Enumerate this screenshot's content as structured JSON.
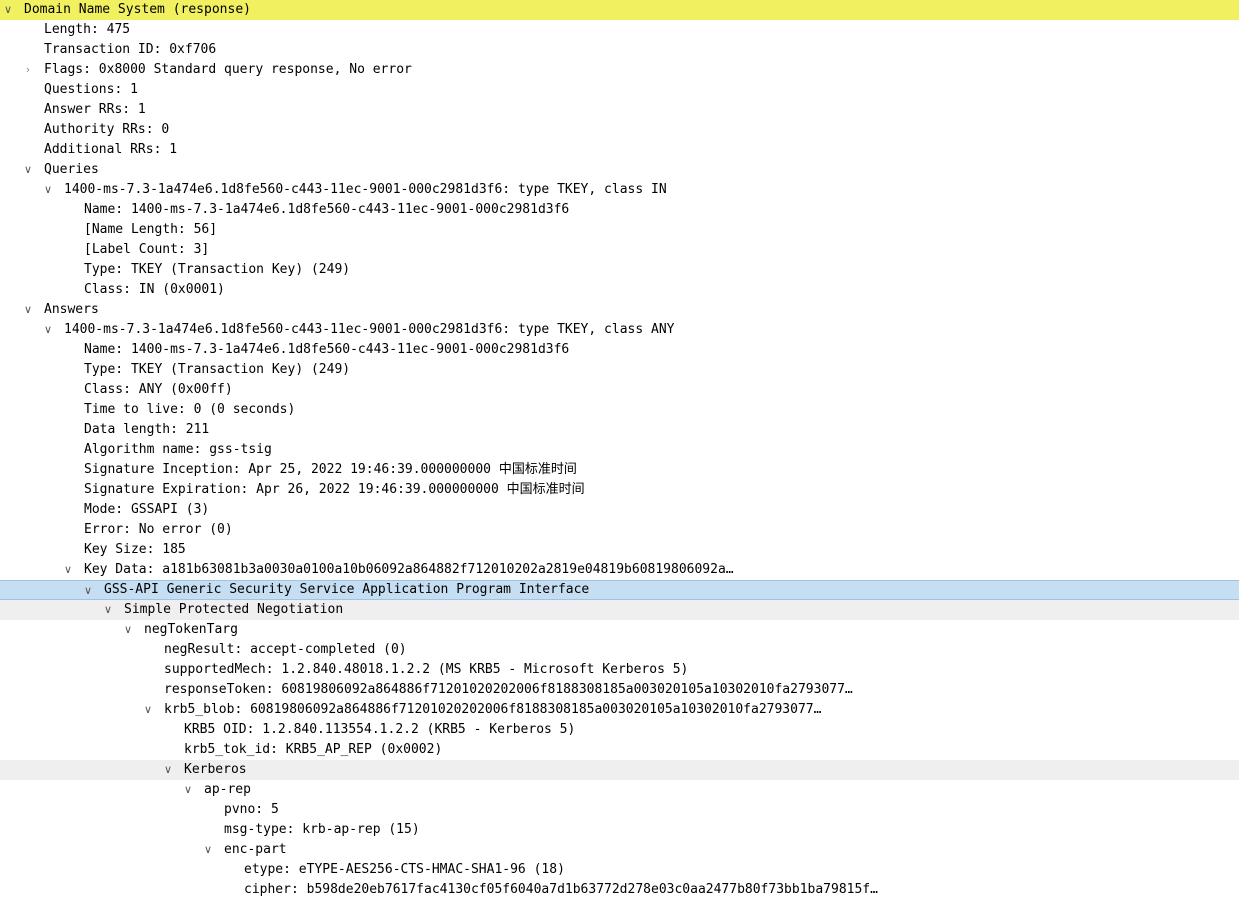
{
  "tree": [
    {
      "level": 0,
      "toggle": "expanded",
      "hl": "yellow",
      "text": "Domain Name System (response)"
    },
    {
      "level": 1,
      "toggle": "none",
      "text": "Length: 475"
    },
    {
      "level": 1,
      "toggle": "none",
      "text": "Transaction ID: 0xf706"
    },
    {
      "level": 1,
      "toggle": "collapsed",
      "text": "Flags: 0x8000 Standard query response, No error"
    },
    {
      "level": 1,
      "toggle": "none",
      "text": "Questions: 1"
    },
    {
      "level": 1,
      "toggle": "none",
      "text": "Answer RRs: 1"
    },
    {
      "level": 1,
      "toggle": "none",
      "text": "Authority RRs: 0"
    },
    {
      "level": 1,
      "toggle": "none",
      "text": "Additional RRs: 1"
    },
    {
      "level": 1,
      "toggle": "expanded",
      "text": "Queries"
    },
    {
      "level": 2,
      "toggle": "expanded",
      "text": "1400-ms-7.3-1a474e6.1d8fe560-c443-11ec-9001-000c2981d3f6: type TKEY, class IN"
    },
    {
      "level": 3,
      "toggle": "none",
      "text": "Name: 1400-ms-7.3-1a474e6.1d8fe560-c443-11ec-9001-000c2981d3f6"
    },
    {
      "level": 3,
      "toggle": "none",
      "text": "[Name Length: 56]"
    },
    {
      "level": 3,
      "toggle": "none",
      "text": "[Label Count: 3]"
    },
    {
      "level": 3,
      "toggle": "none",
      "text": "Type: TKEY (Transaction Key) (249)"
    },
    {
      "level": 3,
      "toggle": "none",
      "text": "Class: IN (0x0001)"
    },
    {
      "level": 1,
      "toggle": "expanded",
      "text": "Answers"
    },
    {
      "level": 2,
      "toggle": "expanded",
      "text": "1400-ms-7.3-1a474e6.1d8fe560-c443-11ec-9001-000c2981d3f6: type TKEY, class ANY"
    },
    {
      "level": 3,
      "toggle": "none",
      "text": "Name: 1400-ms-7.3-1a474e6.1d8fe560-c443-11ec-9001-000c2981d3f6"
    },
    {
      "level": 3,
      "toggle": "none",
      "text": "Type: TKEY (Transaction Key) (249)"
    },
    {
      "level": 3,
      "toggle": "none",
      "text": "Class: ANY (0x00ff)"
    },
    {
      "level": 3,
      "toggle": "none",
      "text": "Time to live: 0 (0 seconds)"
    },
    {
      "level": 3,
      "toggle": "none",
      "text": "Data length: 211"
    },
    {
      "level": 3,
      "toggle": "none",
      "text": "Algorithm name: gss-tsig"
    },
    {
      "level": 3,
      "toggle": "none",
      "text": "Signature Inception: Apr 25, 2022 19:46:39.000000000 中国标准时间"
    },
    {
      "level": 3,
      "toggle": "none",
      "text": "Signature Expiration: Apr 26, 2022 19:46:39.000000000 中国标准时间"
    },
    {
      "level": 3,
      "toggle": "none",
      "text": "Mode: GSSAPI (3)"
    },
    {
      "level": 3,
      "toggle": "none",
      "text": "Error: No error (0)"
    },
    {
      "level": 3,
      "toggle": "none",
      "text": "Key Size: 185"
    },
    {
      "level": 3,
      "toggle": "expanded",
      "text": "Key Data: a181b63081b3a0030a0100a10b06092a864882f712010202a2819e04819b60819806092a…"
    },
    {
      "level": 4,
      "toggle": "expanded",
      "hl": "blue",
      "text": "GSS-API Generic Security Service Application Program Interface"
    },
    {
      "level": 5,
      "toggle": "expanded",
      "hl": "gray",
      "text": "Simple Protected Negotiation"
    },
    {
      "level": 6,
      "toggle": "expanded",
      "text": "negTokenTarg"
    },
    {
      "level": 7,
      "toggle": "none",
      "text": "negResult: accept-completed (0)"
    },
    {
      "level": 7,
      "toggle": "none",
      "text": "supportedMech: 1.2.840.48018.1.2.2 (MS KRB5 - Microsoft Kerberos 5)"
    },
    {
      "level": 7,
      "toggle": "none",
      "text": "responseToken: 60819806092a864886f71201020202006f8188308185a003020105a10302010fa2793077…"
    },
    {
      "level": 7,
      "toggle": "expanded",
      "text": "krb5_blob: 60819806092a864886f71201020202006f8188308185a003020105a10302010fa2793077…"
    },
    {
      "level": 8,
      "toggle": "none",
      "text": "KRB5 OID: 1.2.840.113554.1.2.2 (KRB5 - Kerberos 5)"
    },
    {
      "level": 8,
      "toggle": "none",
      "text": "krb5_tok_id: KRB5_AP_REP (0x0002)"
    },
    {
      "level": 8,
      "toggle": "expanded",
      "hl": "gray",
      "text": "Kerberos"
    },
    {
      "level": 9,
      "toggle": "expanded",
      "text": "ap-rep"
    },
    {
      "level": 10,
      "toggle": "none",
      "text": "pvno: 5"
    },
    {
      "level": 10,
      "toggle": "none",
      "text": "msg-type: krb-ap-rep (15)"
    },
    {
      "level": 10,
      "toggle": "expanded",
      "text": "enc-part"
    },
    {
      "level": 11,
      "toggle": "none",
      "text": "etype: eTYPE-AES256-CTS-HMAC-SHA1-96 (18)"
    },
    {
      "level": 11,
      "toggle": "none",
      "text": "cipher: b598de20eb7617fac4130cf05f6040a7d1b63772d278e03c0aa2477b80f73bb1ba79815f…"
    }
  ],
  "icons": {
    "expanded": "chevron-down-icon",
    "collapsed": "chevron-right-icon"
  },
  "colors": {
    "selected_row": "#f0f060",
    "focus_row": "#c6def2",
    "hover_row": "#efefef"
  }
}
